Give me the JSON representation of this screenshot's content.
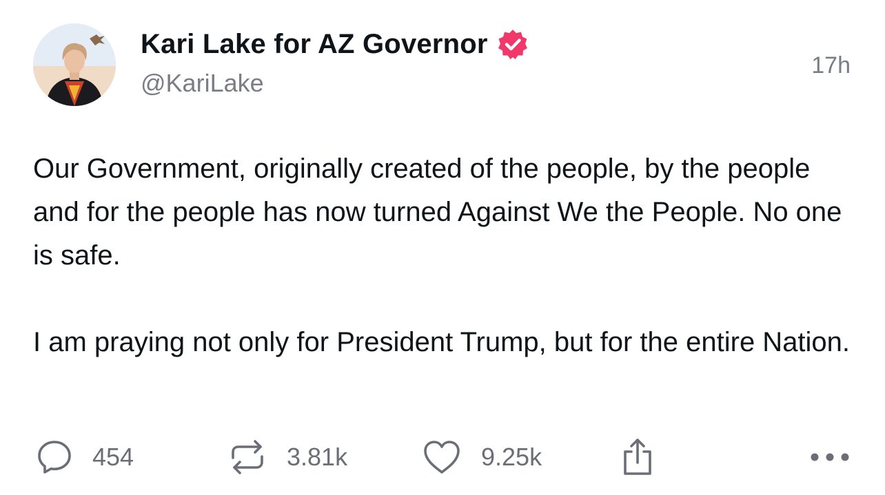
{
  "author": {
    "display_name": "Kari Lake for AZ Governor",
    "handle": "@KariLake",
    "verified": true,
    "verified_badge_icon": "verified-badge-icon",
    "avatar": "profile-photo"
  },
  "post": {
    "timestamp": "17h",
    "paragraphs": [
      "Our Government, originally created of the people, by the people and for the people has now turned Against We the People. No one is safe.",
      "I am praying not only for President Trump, but for the entire Nation."
    ]
  },
  "actions": {
    "reply": {
      "icon": "reply-icon",
      "count": "454"
    },
    "repost": {
      "icon": "repost-icon",
      "count": "3.81k"
    },
    "like": {
      "icon": "heart-icon",
      "count": "9.25k"
    },
    "share": {
      "icon": "share-icon"
    },
    "more": {
      "icon": "more-options-icon"
    }
  },
  "colors": {
    "text_primary": "#0f1419",
    "text_secondary": "#7b7d86",
    "action_gray": "#6b6e76",
    "verified_accent": "#f2376b"
  }
}
